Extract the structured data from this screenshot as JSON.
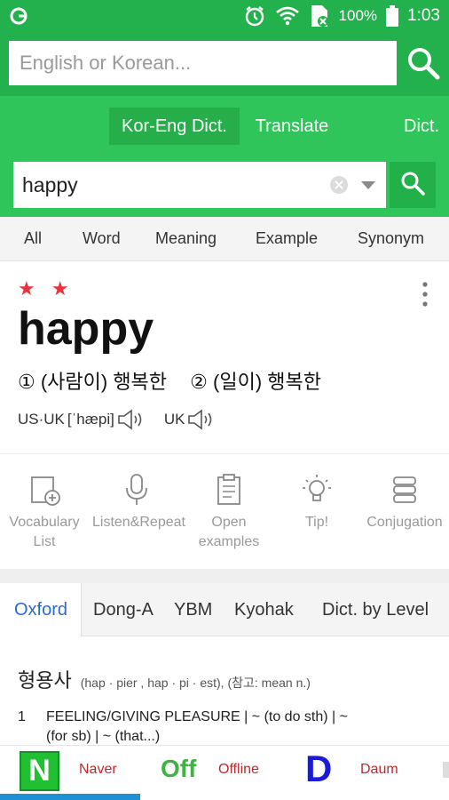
{
  "status_bar": {
    "battery": "100%",
    "time": "1:03"
  },
  "top_search": {
    "placeholder": "English or Korean..."
  },
  "dict_tabs": [
    {
      "label": "Kor-Eng Dict.",
      "active": true
    },
    {
      "label": "Translate",
      "active": false
    },
    {
      "label": "Dict.",
      "active": false
    }
  ],
  "query": {
    "value": "happy"
  },
  "filters": [
    "All",
    "Word",
    "Meaning",
    "Example",
    "Synonym"
  ],
  "entry": {
    "stars": "★ ★",
    "word": "happy",
    "meaning_1": "① (사람이) 행복한",
    "meaning_2": "② (일이) 행복한",
    "pron_us_label": "US·UK",
    "pron_us_ipa": "[ˈhæpi]",
    "pron_uk_label": "UK"
  },
  "actions": [
    {
      "label": "Vocabulary List",
      "icon": "add-to-vocabulary-icon"
    },
    {
      "label": "Listen&Repeat",
      "icon": "microphone-icon"
    },
    {
      "label": "Open examples",
      "icon": "clipboard-icon"
    },
    {
      "label": "Tip!",
      "icon": "lightbulb-icon"
    },
    {
      "label": "Conjugation",
      "icon": "stack-icon"
    }
  ],
  "source_tabs": [
    {
      "label": "Oxford",
      "active": true
    },
    {
      "label": "Dong-A",
      "active": false
    },
    {
      "label": "YBM",
      "active": false
    },
    {
      "label": "Kyohak",
      "active": false
    },
    {
      "label": "Dict. by Level",
      "active": false
    }
  ],
  "content": {
    "pos": "형용사",
    "forms": "(hap · pier , hap · pi · est), (참고: mean n.)",
    "sense_num": "1",
    "sense_text": "FEELING/GIVING PLEASURE | ~ (to do sth) | ~",
    "sense_text_2": "(for sb) | ~ (that...)"
  },
  "bottom_bar": {
    "naver_logo": "N",
    "naver_label": "Naver",
    "offline_logo": "Off",
    "offline_label": "Offline",
    "daum_logo": "D",
    "daum_label": "Daum"
  },
  "colors": {
    "brand_green": "#22b14c",
    "active_tab_blue": "#2a6bd1",
    "star_red": "#e8323c",
    "progress_blue": "#1e90d6"
  }
}
